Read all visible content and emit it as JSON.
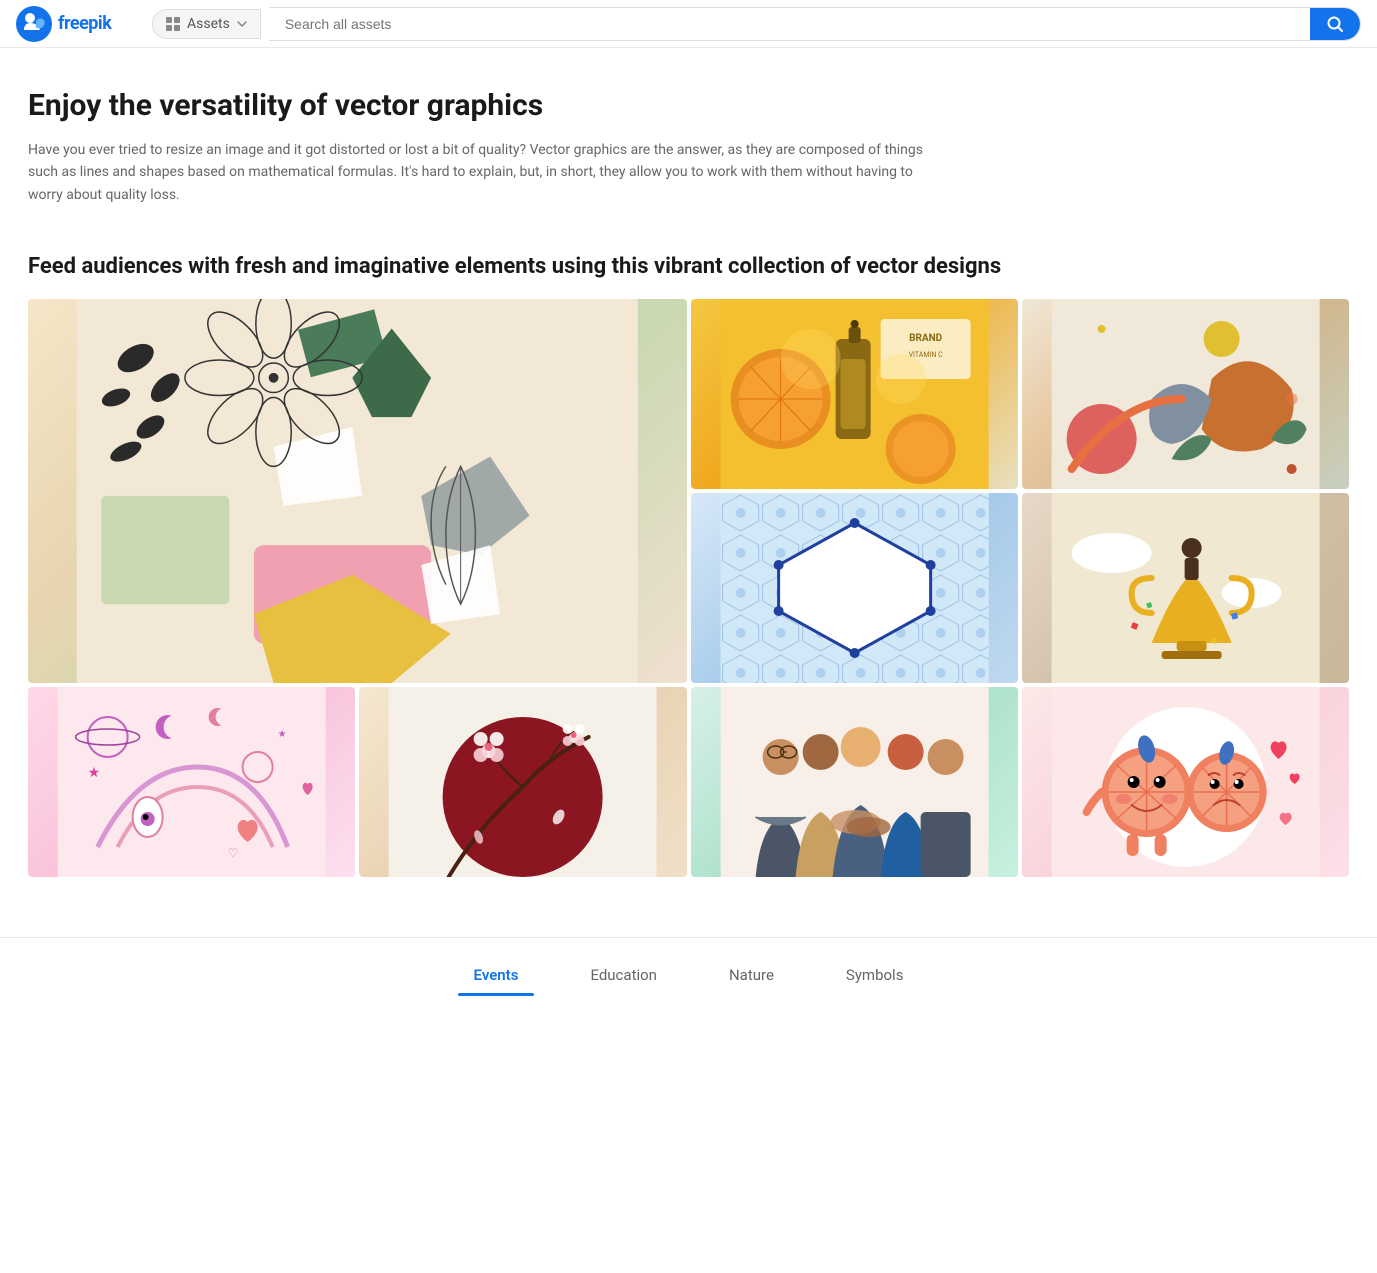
{
  "header": {
    "logo_text": "freepik",
    "assets_label": "Assets",
    "search_placeholder": "Search all assets",
    "search_button_label": "Search"
  },
  "main": {
    "page_title": "Enjoy the versatility of vector graphics",
    "page_description": "Have you ever tried to resize an image and it got distorted or lost a bit of quality? Vector graphics are the answer, as they are composed of things such as lines and shapes based on mathematical formulas. It's hard to explain, but, in short, they allow you to work with them without having to worry about quality loss.",
    "section_title": "Feed audiences with fresh and imaginative elements using this vibrant collection of vector designs",
    "grid_items": [
      {
        "id": 1,
        "class": "img-1",
        "large": true,
        "alt": "Floral collage art with flower illustration"
      },
      {
        "id": 2,
        "class": "img-2",
        "large": false,
        "alt": "Brand vitamin c serum with orange slices"
      },
      {
        "id": 3,
        "class": "img-3",
        "large": false,
        "alt": "Abstract colorful shapes boho design"
      },
      {
        "id": 4,
        "class": "img-4",
        "large": false,
        "alt": "Geometric hexagon pattern tile frame"
      },
      {
        "id": 5,
        "class": "img-5",
        "large": false,
        "alt": "Business person standing on trophy concept"
      },
      {
        "id": 6,
        "class": "img-6",
        "large": false,
        "alt": "Psychedelic space rainbow pattern pink"
      },
      {
        "id": 7,
        "class": "img-7",
        "large": false,
        "alt": "Cherry blossom branch red circle"
      },
      {
        "id": 8,
        "class": "img-8",
        "large": false,
        "alt": "People teamwork handshake illustration"
      },
      {
        "id": 9,
        "class": "img-9",
        "large": false,
        "alt": "Cute fruit characters with hearts"
      }
    ],
    "tabs": [
      {
        "id": "events",
        "label": "Events",
        "active": true
      },
      {
        "id": "education",
        "label": "Education",
        "active": false
      },
      {
        "id": "nature",
        "label": "Nature",
        "active": false
      },
      {
        "id": "symbols",
        "label": "Symbols",
        "active": false
      }
    ]
  }
}
